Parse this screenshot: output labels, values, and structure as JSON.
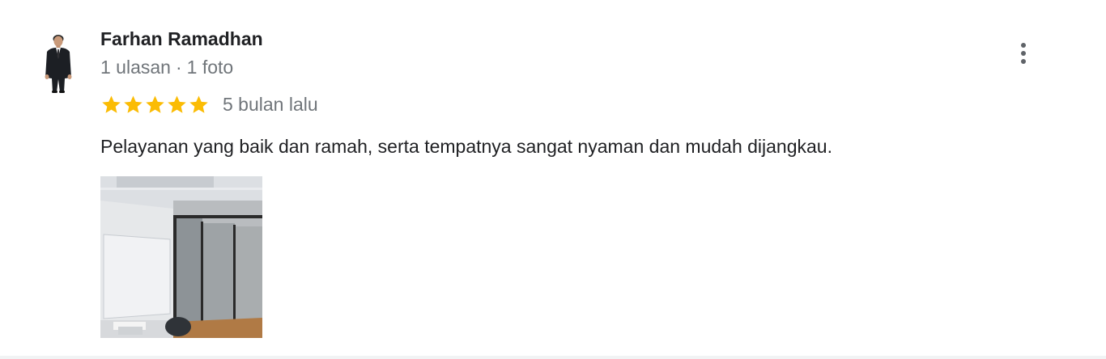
{
  "review": {
    "author_name": "Farhan Ramadhan",
    "review_count": "1 ulasan",
    "separator": "·",
    "photo_count": "1 foto",
    "rating": 5,
    "rating_max": 5,
    "relative_time": "5 bulan lalu",
    "text": "Pelayanan yang baik dan ramah, serta tempatnya sangat nyaman dan mudah dijangkau.",
    "photos": [
      {
        "subject": "office-interior"
      }
    ]
  },
  "icons": {
    "avatar": "person-avatar",
    "menu": "more-vert-icon",
    "star": "star-icon"
  },
  "colors": {
    "star": "#fbbc04",
    "name": "#202124",
    "secondary": "#70757a",
    "menu": "#5f6368"
  }
}
